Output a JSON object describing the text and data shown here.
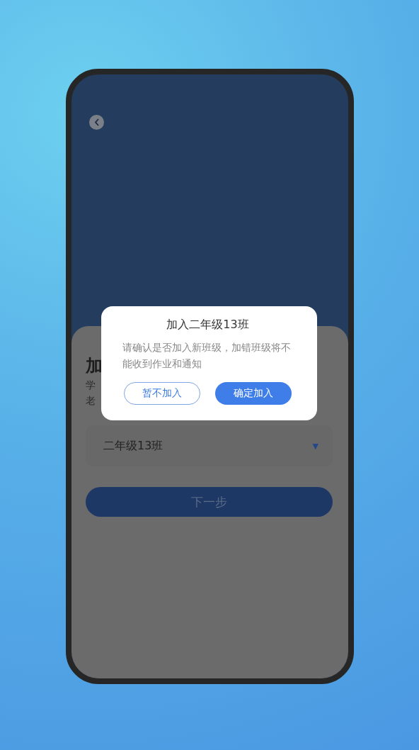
{
  "header": {
    "back_button": true
  },
  "sheet": {
    "title": "加",
    "description_lines": [
      "学",
      "老"
    ],
    "class_select": {
      "value": "二年级13班",
      "arrow": "▼"
    },
    "next_button": {
      "label": "下一步",
      "disabled": true
    }
  },
  "dialog": {
    "title": "加入二年级13班",
    "message": "请确认是否加入新班级，加错班级将不能收到作业和通知",
    "buttons": [
      {
        "label": "暂不加入",
        "kind": "secondary"
      },
      {
        "label": "确定加入",
        "kind": "primary"
      }
    ]
  }
}
